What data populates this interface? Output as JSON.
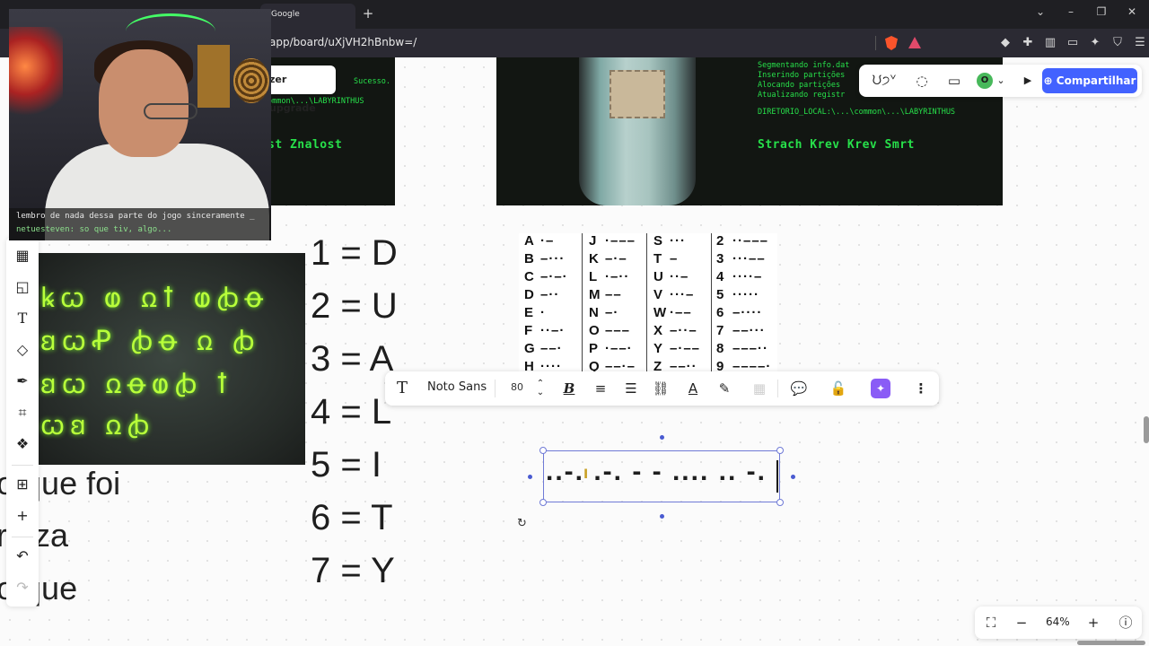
{
  "browser": {
    "tab_title": "Google",
    "new_tab": "+",
    "url": "app/board/uXjVH2hBnbw=/",
    "win_min": "⌄",
    "win_minimize": "–",
    "win_restore": "❐",
    "win_close": "✕"
  },
  "webcam": {
    "chat_line1": "lembro de nada dessa parte do jogo sinceramente _",
    "chat_line2": "netuesteven: so que tiv, algo..."
  },
  "upgrade_button": "zer upgrade",
  "terminal_left": {
    "lines": [
      "Sucesso.",
      "ommon\\...\\LABYRINTHUS"
    ],
    "big": "st Znalost"
  },
  "terminal_right": {
    "lines": [
      "Segmentando info.dat",
      "Inserindo partições",
      "Alocando partições",
      "Atualizando registr",
      "DIRETORIO_LOCAL:\\...\\common\\...\\LABYRINTHUS"
    ],
    "big": "Strach Krev Krev Smrt"
  },
  "symbols": {
    "rows": [
      "ꝃꞷ ⱷ ꭥꝉ ⱷꞗꝋ",
      "ꞛꞷꝒ ꞗꝋ ꭥ ꞗ",
      "ꞛꞷ ꭥꝋⱷꞗ ꝉ",
      "ꞷꞛ ꭥꞗ"
    ]
  },
  "cut_text": [
    "o que foi",
    "raíza",
    "o que"
  ],
  "number_map": [
    "1 = D",
    "2 = U",
    "3 = A",
    "4 = L",
    "5 = I",
    "6 = T",
    "7 = Y"
  ],
  "morse_table": {
    "col1": [
      [
        "A",
        "·–"
      ],
      [
        "B",
        "–···"
      ],
      [
        "C",
        "–·–·"
      ],
      [
        "D",
        "–··"
      ],
      [
        "E",
        "·"
      ],
      [
        "F",
        "··–·"
      ],
      [
        "G",
        "––·"
      ],
      [
        "H",
        "····"
      ]
    ],
    "col2": [
      [
        "J",
        "·–––"
      ],
      [
        "K",
        "–·–"
      ],
      [
        "L",
        "·–··"
      ],
      [
        "M",
        "––"
      ],
      [
        "N",
        "–·"
      ],
      [
        "O",
        "–––"
      ],
      [
        "P",
        "·––·"
      ],
      [
        "Q",
        "––·–"
      ]
    ],
    "col3": [
      [
        "S",
        "···"
      ],
      [
        "T",
        "–"
      ],
      [
        "U",
        "··–"
      ],
      [
        "V",
        "···–"
      ],
      [
        "W",
        "·––"
      ],
      [
        "X",
        "–··–"
      ],
      [
        "Y",
        "–·––"
      ],
      [
        "Z",
        "––··"
      ]
    ],
    "col4": [
      [
        "2",
        "··–––"
      ],
      [
        "3",
        "···––"
      ],
      [
        "4",
        "····–"
      ],
      [
        "5",
        "·····"
      ],
      [
        "6",
        "–····"
      ],
      [
        "7",
        "––···"
      ],
      [
        "8",
        "–––··"
      ],
      [
        "9",
        "––––·"
      ]
    ]
  },
  "text_toolbar": {
    "font": "Noto Sans",
    "size": "80"
  },
  "selected_text": "..-. .-. - - .... .. -.",
  "top_right": {
    "reactions": "ᙀ੭ᘁ",
    "share": "Compartilhar",
    "avatar_initial": "O"
  },
  "zoom": {
    "value": "64%"
  }
}
